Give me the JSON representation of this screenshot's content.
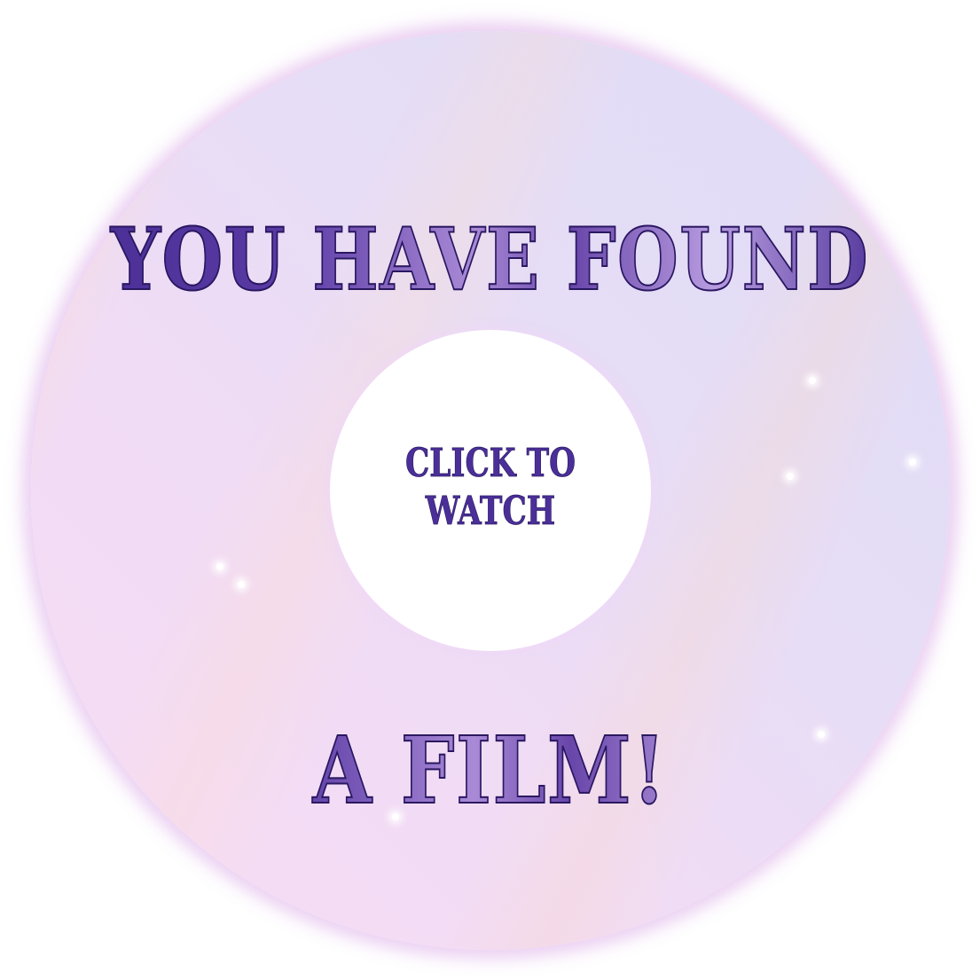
{
  "disc": {
    "headline_top": "YOU HAVE FOUND",
    "headline_bottom": "A FILM!",
    "cta_line1": "CLICK TO",
    "cta_line2": "WATCH"
  },
  "colors": {
    "text_purple": "#4b2f99",
    "disc_pink": "#f7dcf4",
    "disc_lavender": "#dedcf7",
    "glow": "#e8c8f0"
  }
}
